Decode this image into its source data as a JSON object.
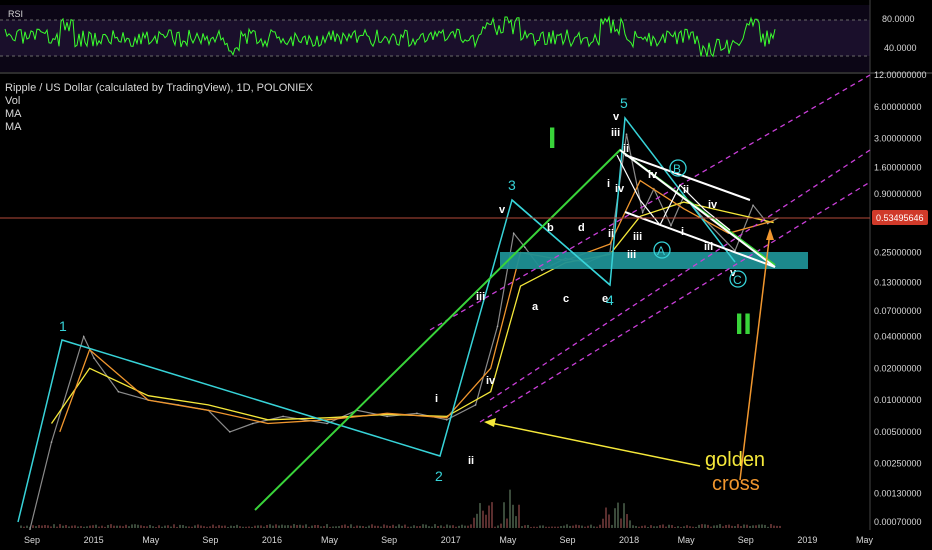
{
  "rsi_panel": {
    "label": "RSI",
    "levels": [
      "80.0000",
      "40.0000"
    ],
    "upper_level": 80,
    "lower_level": 40
  },
  "header": {
    "title": "Ripple / US Dollar (calculated by TradingView), 1D, POLONIEX",
    "indicators": [
      "Vol",
      "MA",
      "MA"
    ]
  },
  "price_label": "0.53495646",
  "colors": {
    "background": "#000000",
    "rsi_line": "#3bff2e",
    "cyan": "#37d3d8",
    "green": "#39d43a",
    "yellow": "#f5e83a",
    "orange": "#f0962e",
    "magenta": "#c93fd8",
    "white": "#ffffff",
    "teal_zone": "#1e8f94",
    "price_line": "#b44a3a"
  },
  "chart_data": {
    "type": "line",
    "scale": "log",
    "y_tick_labels": [
      "12.00000000",
      "6.00000000",
      "3.00000000",
      "1.60000000",
      "0.90000000",
      "0.53495646",
      "0.25000000",
      "0.13000000",
      "0.07000000",
      "0.04000000",
      "0.02000000",
      "0.01000000",
      "0.00500000",
      "0.00250000",
      "0.00130000",
      "0.00070000"
    ],
    "x_tick_labels": [
      "Sep",
      "2015",
      "May",
      "Sep",
      "2016",
      "May",
      "Sep",
      "2017",
      "May",
      "Sep",
      "2018",
      "May",
      "Sep",
      "2019",
      "May"
    ],
    "x_tick_dates": [
      "2014-09-01",
      "2015-01-01",
      "2015-05-01",
      "2015-09-01",
      "2016-01-01",
      "2016-05-01",
      "2016-09-01",
      "2017-01-01",
      "2017-05-01",
      "2017-09-01",
      "2018-01-01",
      "2018-05-01",
      "2018-09-01",
      "2019-01-01",
      "2019-05-01"
    ],
    "current_price": 0.53495646,
    "price_series": [
      [
        "2014-09-01",
        0.0006
      ],
      [
        "2014-10-15",
        0.004
      ],
      [
        "2014-12-20",
        0.04
      ],
      [
        "2015-01-10",
        0.025
      ],
      [
        "2015-03-01",
        0.012
      ],
      [
        "2015-05-01",
        0.01
      ],
      [
        "2015-07-01",
        0.009
      ],
      [
        "2015-09-01",
        0.008
      ],
      [
        "2015-10-15",
        0.005
      ],
      [
        "2015-12-01",
        0.006
      ],
      [
        "2016-02-01",
        0.007
      ],
      [
        "2016-05-01",
        0.006
      ],
      [
        "2016-07-01",
        0.008
      ],
      [
        "2016-09-01",
        0.007
      ],
      [
        "2016-11-01",
        0.0075
      ],
      [
        "2017-01-01",
        0.0065
      ],
      [
        "2017-03-01",
        0.009
      ],
      [
        "2017-04-15",
        0.05
      ],
      [
        "2017-05-18",
        0.38
      ],
      [
        "2017-06-10",
        0.28
      ],
      [
        "2017-07-15",
        0.17
      ],
      [
        "2017-09-01",
        0.22
      ],
      [
        "2017-10-15",
        0.2
      ],
      [
        "2017-12-01",
        0.25
      ],
      [
        "2018-01-04",
        3.3
      ],
      [
        "2018-02-06",
        0.6
      ],
      [
        "2018-03-01",
        1.0
      ],
      [
        "2018-04-05",
        0.45
      ],
      [
        "2018-05-01",
        0.85
      ],
      [
        "2018-06-15",
        0.5
      ],
      [
        "2018-08-14",
        0.26
      ],
      [
        "2018-09-20",
        0.7
      ],
      [
        "2018-10-20",
        0.47
      ],
      [
        "2018-11-10",
        0.53
      ]
    ],
    "ma_series": {
      "ma_yellow": [
        [
          "2014-10-15",
          0.006
        ],
        [
          "2015-01-01",
          0.02
        ],
        [
          "2015-05-01",
          0.011
        ],
        [
          "2015-09-01",
          0.009
        ],
        [
          "2016-01-01",
          0.0065
        ],
        [
          "2016-05-01",
          0.0068
        ],
        [
          "2016-09-01",
          0.0073
        ],
        [
          "2017-01-01",
          0.007
        ],
        [
          "2017-04-01",
          0.012
        ],
        [
          "2017-06-01",
          0.12
        ],
        [
          "2017-09-01",
          0.2
        ],
        [
          "2017-12-01",
          0.24
        ],
        [
          "2018-02-01",
          0.55
        ],
        [
          "2018-05-01",
          0.75
        ],
        [
          "2018-08-01",
          0.6
        ],
        [
          "2018-11-01",
          0.48
        ]
      ],
      "ma_orange": [
        [
          "2014-11-01",
          0.005
        ],
        [
          "2015-01-01",
          0.03
        ],
        [
          "2015-05-01",
          0.01
        ],
        [
          "2015-09-01",
          0.008
        ],
        [
          "2016-01-01",
          0.006
        ],
        [
          "2016-05-01",
          0.0065
        ],
        [
          "2016-09-01",
          0.0075
        ],
        [
          "2017-01-01",
          0.0068
        ],
        [
          "2017-04-01",
          0.02
        ],
        [
          "2017-06-01",
          0.25
        ],
        [
          "2017-09-01",
          0.21
        ],
        [
          "2017-12-01",
          0.3
        ],
        [
          "2018-02-01",
          1.2
        ],
        [
          "2018-05-01",
          0.65
        ],
        [
          "2018-08-01",
          0.38
        ],
        [
          "2018-11-01",
          0.5
        ]
      ]
    }
  },
  "annotations": {
    "wave_labels": [
      {
        "text": "1",
        "color": "cyan"
      },
      {
        "text": "2",
        "color": "cyan"
      },
      {
        "text": "3",
        "color": "cyan"
      },
      {
        "text": "4",
        "color": "cyan"
      },
      {
        "text": "5",
        "color": "cyan"
      },
      {
        "text": "I",
        "color": "green"
      },
      {
        "text": "II",
        "color": "green"
      }
    ],
    "sub_labels": [
      "i",
      "ii",
      "iii",
      "iv",
      "v",
      "a",
      "b",
      "c",
      "d",
      "e",
      "v",
      "iii",
      "ii",
      "i",
      "iv",
      "iii",
      "ii",
      "i",
      "iv",
      "iii",
      "v",
      "ii",
      "iv",
      "iii"
    ],
    "circle_labels": [
      "A",
      "B",
      "C"
    ],
    "golden_cross": [
      "golden",
      "cross"
    ]
  }
}
